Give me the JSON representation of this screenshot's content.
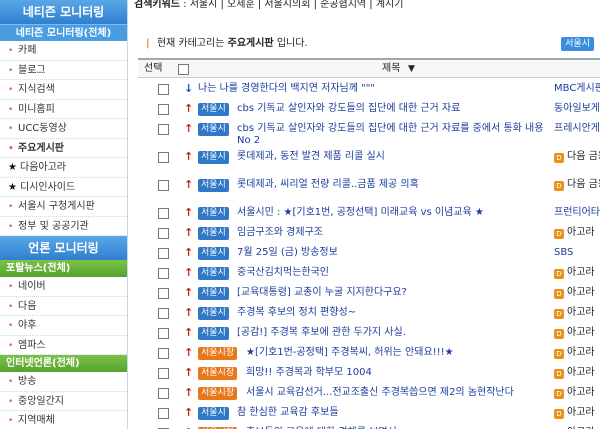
{
  "sidebar": {
    "section1_title": "네티즌 모니터링",
    "section1_sub": "네티즌 모니터링(전체)",
    "section1_items": [
      {
        "label": "카페",
        "mark": "•"
      },
      {
        "label": "블로그",
        "mark": "•"
      },
      {
        "label": "지식검색",
        "mark": "•"
      },
      {
        "label": "미니홈피",
        "mark": "•"
      },
      {
        "label": "UCC동영상",
        "mark": "•"
      },
      {
        "label": "주요게시판",
        "mark": "•"
      },
      {
        "label": "다음아고라",
        "mark": "★"
      },
      {
        "label": "디시인사이드",
        "mark": "★"
      },
      {
        "label": "서울시 구청게시판",
        "mark": "•"
      },
      {
        "label": "정부 및 공공기관",
        "mark": "•"
      }
    ],
    "section2_title": "언론 모니터링",
    "portal_title": "포탈뉴스(전체)",
    "portal_items": [
      "네이버",
      "다음",
      "야후",
      "엠파스"
    ],
    "internet_title": "인터넷언론(전체)",
    "internet_items": [
      "방송",
      "중앙일간지",
      "지역매체"
    ]
  },
  "keyword_bar": {
    "label": "검색키워드",
    "items": ": 서울시 | 오세훈 | 서울시의회 | 순공협지역 | 계시기"
  },
  "category_bar": {
    "text_prefix": "현재 카테고리는",
    "category": "주요게시판",
    "text_suffix": "입니다.",
    "badge": "서울시"
  },
  "table": {
    "col_select": "선택",
    "col_title": "제목",
    "sort_icon": "▼",
    "rows": [
      {
        "arrow": "↓",
        "dir": "down",
        "tag": "",
        "tag_color": "",
        "title": "나는 나를 경영한다의 백지연 저자님께 \"\"\"",
        "title_color": "navy",
        "source": "MBC게시판",
        "source_icon": false
      },
      {
        "arrow": "↑",
        "dir": "up",
        "tag": "서울시",
        "tag_color": "blue",
        "title": "cbs 기독교 살인자와 강도들의 집단에 대한 근거 자료",
        "title_color": "navy",
        "source": "동아일보게",
        "source_icon": false
      },
      {
        "arrow": "↑",
        "dir": "up",
        "tag": "서울시",
        "tag_color": "blue",
        "title": "cbs 기독교 살인자와 강도들의 집단에 대한 근거 자료를 중에서 통화 내용 No 2",
        "title_color": "navy",
        "source": "프레시안게",
        "source_icon": false,
        "tall": true
      },
      {
        "arrow": "↑",
        "dir": "up",
        "tag": "서울시",
        "tag_color": "blue",
        "title": "롯데제과, 동전 발견 제품 리콜 실시",
        "title_color": "navy",
        "source": "다음 금융",
        "source_icon": true,
        "tall": true
      },
      {
        "arrow": "↑",
        "dir": "up",
        "tag": "서울시",
        "tag_color": "blue",
        "title": "롯데제과, 씨리얼 전량 리콜..금품 제공 의혹",
        "title_color": "navy",
        "source": "다음 금융",
        "source_icon": true,
        "tall": true
      },
      {
        "arrow": "↑",
        "dir": "up",
        "tag": "서울시",
        "tag_color": "blue",
        "title": "서울시민 : ★[기호1번, 공정선택] 미래교육 vs 이념교육 ★",
        "title_color": "navy",
        "source": "프런티어타",
        "source_icon": false
      },
      {
        "arrow": "↑",
        "dir": "up",
        "tag": "서울시",
        "tag_color": "blue",
        "title": "임금구조와 경제구조",
        "title_color": "navy",
        "source": "아고라",
        "source_icon": true
      },
      {
        "arrow": "↑",
        "dir": "up",
        "tag": "서울시",
        "tag_color": "blue",
        "title": "7월 25일 (금) 방송정보",
        "title_color": "navy",
        "source": "SBS",
        "source_icon": false
      },
      {
        "arrow": "↑",
        "dir": "up",
        "tag": "서울시",
        "tag_color": "blue",
        "title": "중국산김치먹는한국인",
        "title_color": "navy",
        "source": "아고라",
        "source_icon": true
      },
      {
        "arrow": "↑",
        "dir": "up",
        "tag": "서울시",
        "tag_color": "blue",
        "title": "[교육대통령] 교총이 누굴 지지한다구요?",
        "title_color": "navy",
        "source": "아고라",
        "source_icon": true
      },
      {
        "arrow": "↑",
        "dir": "up",
        "tag": "서울시",
        "tag_color": "blue",
        "title": "주경복 후보의 정치 편향성~",
        "title_color": "navy",
        "source": "아고라",
        "source_icon": true
      },
      {
        "arrow": "↑",
        "dir": "up",
        "tag": "서울시",
        "tag_color": "blue",
        "title": "[공감!] 주경복 후보에 관한 두가지 사실.",
        "title_color": "navy",
        "source": "아고라",
        "source_icon": true
      },
      {
        "arrow": "↑",
        "dir": "up",
        "tag": "서울시장",
        "tag_color": "orange",
        "title": "★[기호1번-공정택] 주경복씨, 허위는 안돼요!!!★",
        "title_color": "navy",
        "source": "아고라",
        "source_icon": true
      },
      {
        "arrow": "↑",
        "dir": "up",
        "tag": "서울시장",
        "tag_color": "orange",
        "title": "희망!! 주경복과 학부모 1004",
        "title_color": "navy",
        "source": "아고라",
        "source_icon": true
      },
      {
        "arrow": "↑",
        "dir": "up",
        "tag": "서울시장",
        "tag_color": "orange",
        "title": "서울시 교육감선거...전교조출신 주경복씁으면 제2의 놈현작난다",
        "title_color": "navy",
        "source": "아고라",
        "source_icon": true
      },
      {
        "arrow": "↑",
        "dir": "up",
        "tag": "서울시",
        "tag_color": "blue",
        "title": "참 한심한 교육감 후보들",
        "title_color": "navy",
        "source": "아고라",
        "source_icon": true
      },
      {
        "arrow": "↑",
        "dir": "up",
        "tag": "서울시장",
        "tag_color": "orange",
        "title": "후보들의 교육에 대한 견해를 보면서,,,",
        "title_color": "navy",
        "source": "아고라",
        "source_icon": true
      }
    ]
  },
  "colors": {
    "sidebar_blue": "#3a8ee0",
    "sidebar_green": "#62ad34",
    "tag_blue": "#2f78c8",
    "tag_orange": "#e8781c",
    "arrow_up": "#d02020",
    "arrow_down": "#2050c0",
    "link_navy": "#1a3c9e"
  }
}
